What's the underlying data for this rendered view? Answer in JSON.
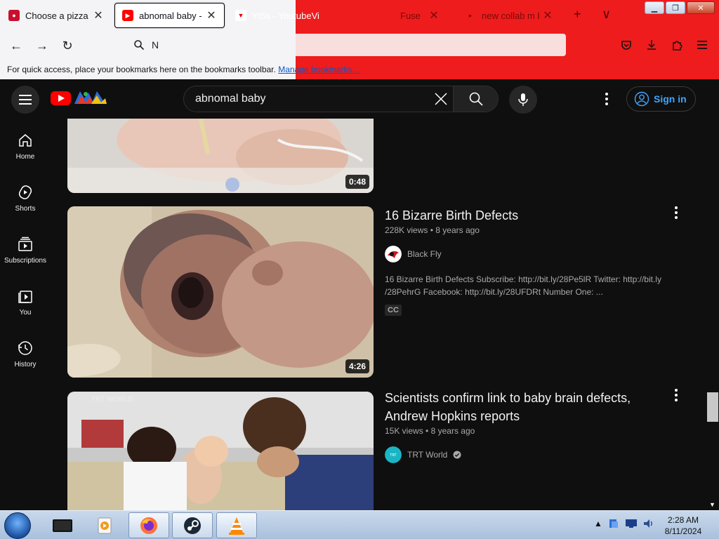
{
  "browser": {
    "tabs": [
      {
        "title": "Choose a pizza | Piz",
        "favicon": "pizza-icon"
      },
      {
        "title": "abnomal baby - Yo",
        "favicon": "youtube-icon",
        "active": true
      },
      {
        "title": "Yt5s - YoutubeVi",
        "favicon": "yt5s-icon"
      },
      {
        "title": "Fuse",
        "favicon": "fuse-icon"
      },
      {
        "title": "new collab m bar",
        "favicon": "youtube-icon"
      }
    ],
    "new_tab_symbol": "+",
    "list_tabs_symbol": "∨",
    "address_text": "N",
    "bookmarks_message": "For quick access, place your bookmarks here on the bookmarks toolbar.",
    "bookmarks_link": "Manage bookmarks…",
    "window_controls": [
      "minimize",
      "maximize",
      "close"
    ]
  },
  "youtube": {
    "search_query": "abnomal baby",
    "sign_in_label": "Sign in",
    "sidebar": [
      {
        "label": "Home",
        "icon": "home-icon"
      },
      {
        "label": "Shorts",
        "icon": "shorts-icon"
      },
      {
        "label": "Subscriptions",
        "icon": "subscriptions-icon"
      },
      {
        "label": "You",
        "icon": "you-icon"
      },
      {
        "label": "History",
        "icon": "history-icon"
      }
    ],
    "results": [
      {
        "duration": "0:48"
      },
      {
        "title": "16 Bizarre Birth Defects",
        "views": "228K views",
        "age": "8 years ago",
        "channel": "Black Fly",
        "description_line1": "16 Bizarre Birth Defects Subscribe: http://bit.ly/28Pe5lR Twitter: http://bit.ly",
        "description_line2": "/28PehrG Facebook: http://bit.ly/28UFDRt Number One: ...",
        "badge": "CC",
        "duration": "4:26"
      },
      {
        "title_line1": "Scientists confirm link to baby brain defects,",
        "title_line2": "Andrew Hopkins reports",
        "views": "15K views",
        "age": "8 years ago",
        "channel": "TRT World",
        "verified": true,
        "thumb_watermark": "TRT WORLD"
      }
    ]
  },
  "taskbar": {
    "time": "2:28 AM",
    "date": "8/11/2024",
    "apps": [
      "terminal-app-icon",
      "media-app-icon",
      "firefox-icon",
      "steam-icon",
      "vlc-icon"
    ]
  },
  "colors": {
    "yt_bg": "#0f0f0f",
    "yt_red": "#ff0000",
    "signin_blue": "#3ea6ff",
    "browser_theme_red": "#ee1c1c"
  }
}
